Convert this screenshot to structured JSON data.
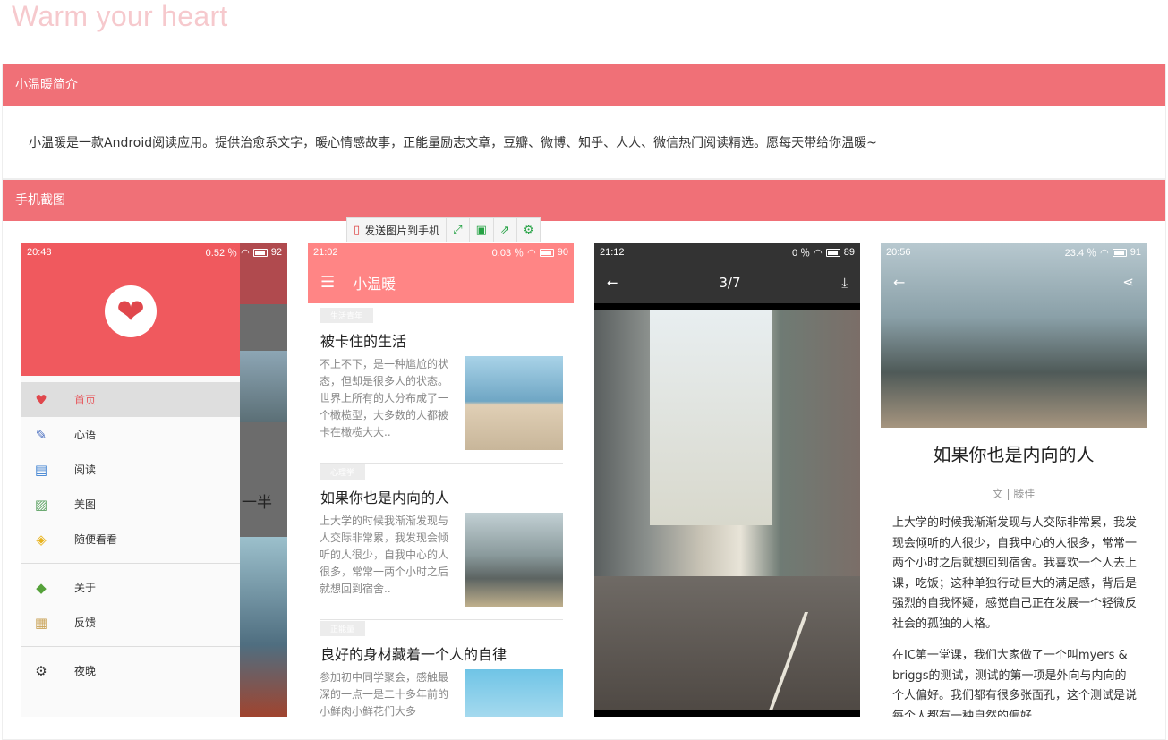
{
  "brand": "Warm your heart",
  "intro": {
    "heading": "小温暖简介",
    "text": "小温暖是一款Android阅读应用。提供治愈系文字，暖心情感故事，正能量励志文章，豆瓣、微博、知乎、人人、微信热门阅读精选。愿每天带给你温暖~"
  },
  "screens_heading": "手机截图",
  "float_toolbar": {
    "send_label": "发送图片到手机"
  },
  "shot1": {
    "time": "20:48",
    "speed": "0.52 ％",
    "battery": "92",
    "menu": [
      {
        "label": "首页",
        "icon": "heart-icon",
        "active": true
      },
      {
        "label": "心语",
        "icon": "pen-icon"
      },
      {
        "label": "阅读",
        "icon": "book-icon"
      },
      {
        "label": "美图",
        "icon": "picture-icon"
      },
      {
        "label": "随便看看",
        "icon": "random-icon"
      }
    ],
    "menu2": [
      {
        "label": "关于",
        "icon": "tag-icon"
      },
      {
        "label": "反馈",
        "icon": "bag-icon"
      }
    ],
    "menu3": [
      {
        "label": "夜晚",
        "icon": "gear-icon"
      }
    ],
    "bg_text": "一半"
  },
  "shot2": {
    "time": "21:02",
    "speed": "0.03 ％",
    "battery": "90",
    "title": "小温暖",
    "articles": [
      {
        "tag": "生活青年",
        "title": "被卡住的生活",
        "text": "不上不下，是一种尴尬的状态，但却是很多人的状态。世界上所有的人分布成了一个橄榄型，大多数的人都被卡在橄榄大大.."
      },
      {
        "tag": "心理学",
        "title": "如果你也是内向的人",
        "text": "上大学的时候我渐渐发现与人交际非常累，我发现会倾听的人很少，自我中心的人很多，常常一两个小时之后就想回到宿舍.."
      },
      {
        "tag": "正能量",
        "title": "良好的身材藏着一个人的自律",
        "text": "参加初中同学聚会，感触最深的一点一是二十多年前的小鲜肉小鲜花们大多"
      }
    ]
  },
  "shot3": {
    "time": "21:12",
    "speed": "0 ％",
    "battery": "89",
    "counter": "3/7"
  },
  "shot4": {
    "time": "20:56",
    "speed": "23.4 ％",
    "battery": "91",
    "title": "如果你也是内向的人",
    "author": "文 | 滕佳",
    "para1": "上大学的时候我渐渐发现与人交际非常累，我发现会倾听的人很少，自我中心的人很多，常常一两个小时之后就想回到宿舍。我喜欢一个人去上课，吃饭；这种单独行动巨大的满足感，背后是强烈的自我怀疑，感觉自己正在发展一个轻微反社会的孤独的人格。",
    "para2": "在IC第一堂课，我们大家做了一个叫myers   &  briggs的测试，测试的第一项是外向与内向的个人偏好。我们都有很多张面孔，这个测试是说每个人都有一种自然的偏好"
  },
  "colors": {
    "accent": "#f07077",
    "brand_text": "#f6c9cd",
    "toolbar_pink": "#ff8585",
    "drawer_red": "#f0595e"
  }
}
